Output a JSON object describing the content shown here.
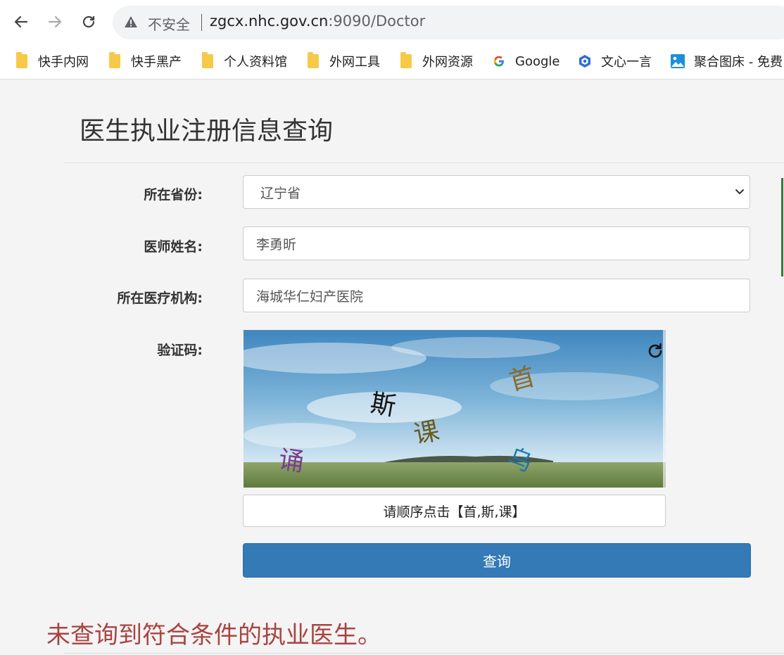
{
  "browser": {
    "security_label": "不安全",
    "url_host": "zgcx.nhc.gov.cn",
    "url_rest": ":9090/Doctor",
    "bookmarks": [
      {
        "label": "快手内网",
        "icon": "folder-icon"
      },
      {
        "label": "快手黑产",
        "icon": "folder-icon"
      },
      {
        "label": "个人资料馆",
        "icon": "folder-icon"
      },
      {
        "label": "外网工具",
        "icon": "folder-icon"
      },
      {
        "label": "外网资源",
        "icon": "folder-icon"
      },
      {
        "label": "Google",
        "icon": "google-icon"
      },
      {
        "label": "文心一言",
        "icon": "wenxin-icon"
      },
      {
        "label": "聚合图床 - 免费",
        "icon": "image-icon"
      }
    ]
  },
  "page": {
    "title": "医生执业注册信息查询",
    "form": {
      "province_label": "所在省份:",
      "province_value": "辽宁省",
      "name_label": "医师姓名:",
      "name_value": "李勇昕",
      "org_label": "所在医疗机构:",
      "org_value": "海城华仁妇产医院",
      "captcha_label": "验证码:",
      "captcha_chars": [
        "斯",
        "首",
        "课",
        "诵",
        "乌"
      ],
      "captcha_hint": "请顺序点击【首,斯,课】",
      "submit_label": "查询"
    },
    "result_message": "未查询到符合条件的执业医生。"
  },
  "colors": {
    "primary_button": "#337ab7",
    "error_text": "#a94442"
  }
}
